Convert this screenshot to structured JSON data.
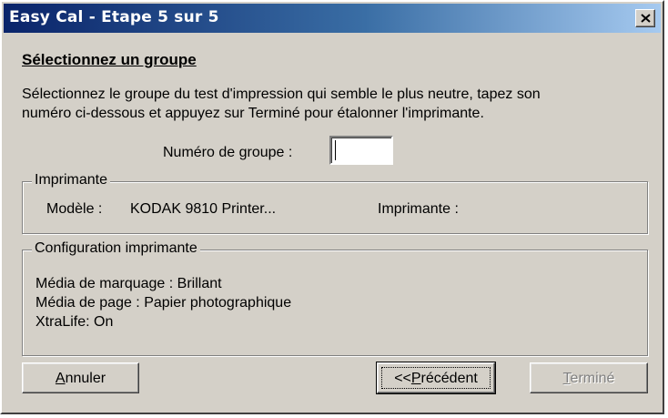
{
  "window": {
    "title": "Easy Cal - Etape 5 sur 5",
    "close_label": "close"
  },
  "heading": "Sélectionnez un groupe",
  "description_line1": "Sélectionnez le groupe du test d'impression qui semble le plus neutre, tapez son",
  "description_line2": "numéro ci-dessous et appuyez sur Terminé pour étalonner l'imprimante.",
  "group": {
    "label": "Numéro de groupe :",
    "value": ""
  },
  "printer_section": {
    "legend": "Imprimante",
    "model_label": "Modèle :",
    "model_value": "KODAK 9810 Printer...",
    "printer_label": "Imprimante :"
  },
  "config_section": {
    "legend": "Configuration imprimante",
    "lines": [
      "Média de marquage : Brillant",
      "Média de page : Papier photographique",
      "XtraLife: On"
    ]
  },
  "buttons": {
    "cancel_first": "A",
    "cancel_rest": "nnuler",
    "previous_prefix": "<<",
    "previous_underlined": "P",
    "previous_rest": "récédent",
    "finish_underlined": "T",
    "finish_rest": "erminé"
  },
  "colors": {
    "window_bg": "#d4d0c8",
    "title_bar_start": "#0a246a",
    "title_bar_end": "#a6caf0",
    "disabled_text": "#808080"
  }
}
